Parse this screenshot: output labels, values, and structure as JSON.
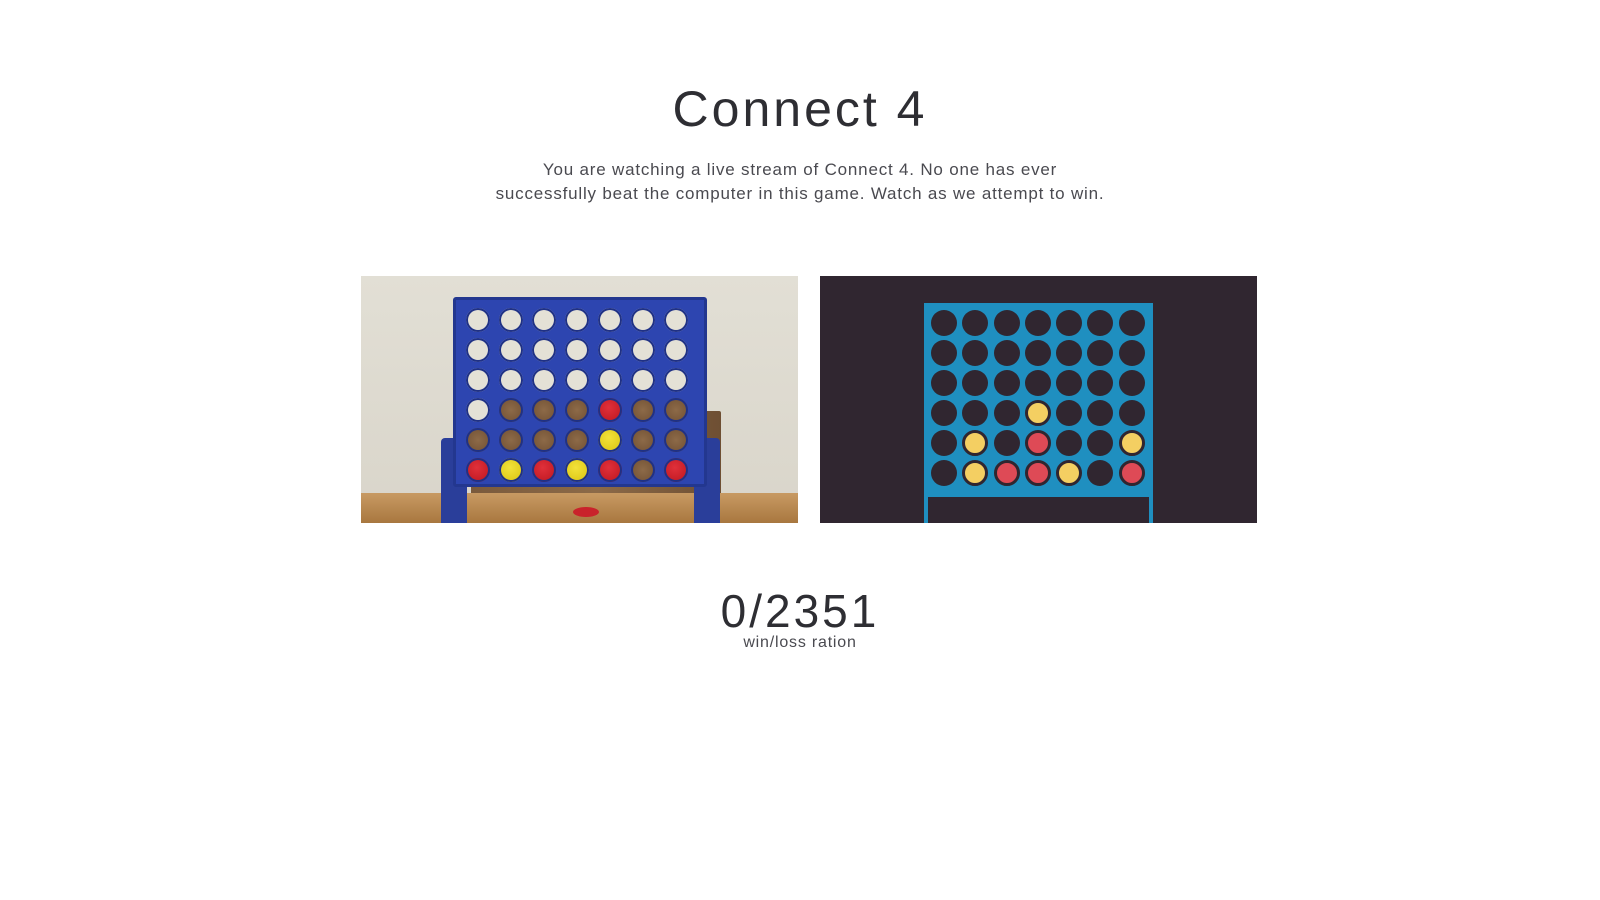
{
  "header": {
    "title": "Connect 4",
    "subtitle_line1": "You are watching a live stream of Connect 4. No one has ever",
    "subtitle_line2": "successfully beat the computer in this game. Watch as we attempt to win."
  },
  "photo_board": {
    "rows": [
      [
        "empty",
        "empty",
        "empty",
        "empty",
        "empty",
        "empty",
        "empty"
      ],
      [
        "empty",
        "empty",
        "empty",
        "empty",
        "empty",
        "empty",
        "empty"
      ],
      [
        "empty",
        "empty",
        "empty",
        "empty",
        "empty",
        "empty",
        "empty"
      ],
      [
        "empty",
        "emptywood",
        "emptywood",
        "emptywood",
        "red",
        "emptywood",
        "emptywood"
      ],
      [
        "emptywood",
        "emptywood",
        "emptywood",
        "emptywood",
        "yellow",
        "emptywood",
        "emptywood"
      ],
      [
        "red",
        "yellow",
        "red",
        "yellow",
        "red",
        "emptywood",
        "red"
      ]
    ]
  },
  "sim_board": {
    "rows": [
      [
        "empty",
        "empty",
        "empty",
        "empty",
        "empty",
        "empty",
        "empty"
      ],
      [
        "empty",
        "empty",
        "empty",
        "empty",
        "empty",
        "empty",
        "empty"
      ],
      [
        "empty",
        "empty",
        "empty",
        "empty",
        "empty",
        "empty",
        "empty"
      ],
      [
        "empty",
        "empty",
        "empty",
        "yellow",
        "empty",
        "empty",
        "empty"
      ],
      [
        "empty",
        "yellow",
        "empty",
        "red",
        "empty",
        "empty",
        "yellow"
      ],
      [
        "empty",
        "yellow",
        "red",
        "red",
        "yellow",
        "empty",
        "red"
      ]
    ]
  },
  "stats": {
    "score": "0/2351",
    "label": "win/loss ration"
  },
  "colors": {
    "board_blue": "#1f8fc0",
    "board_dark": "#302630",
    "piece_yellow": "#f4cf62",
    "piece_red": "#de4a56"
  }
}
